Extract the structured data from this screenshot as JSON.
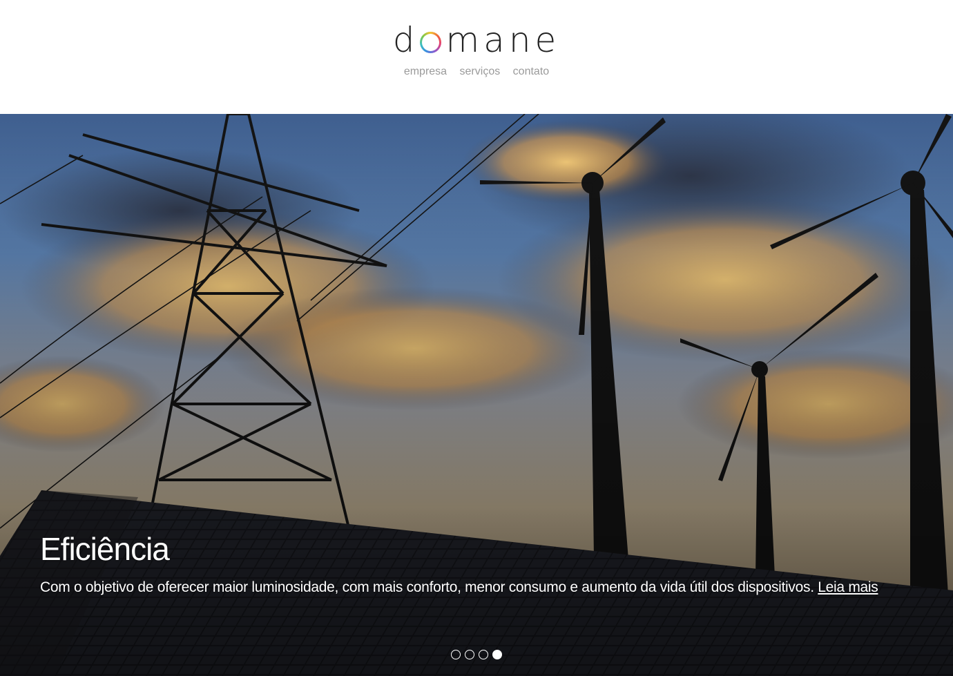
{
  "brand": {
    "logo_prefix": "d",
    "logo_suffix": "mane",
    "logo_ring_icon": "multicolor-ring-icon"
  },
  "nav": {
    "items": [
      {
        "label": "empresa"
      },
      {
        "label": "serviços"
      },
      {
        "label": "contato"
      }
    ],
    "color": "#9a9a9a"
  },
  "hero": {
    "image": "power-lines-wind-turbines-solar-panels-sunset",
    "title": "Eficiência",
    "text": "Com o objetivo de oferecer maior luminosidade, com mais conforto, menor consumo e aumento da vida útil dos dispositivos.",
    "link_label": "Leia mais",
    "slides_count": 4,
    "active_slide": 4
  }
}
